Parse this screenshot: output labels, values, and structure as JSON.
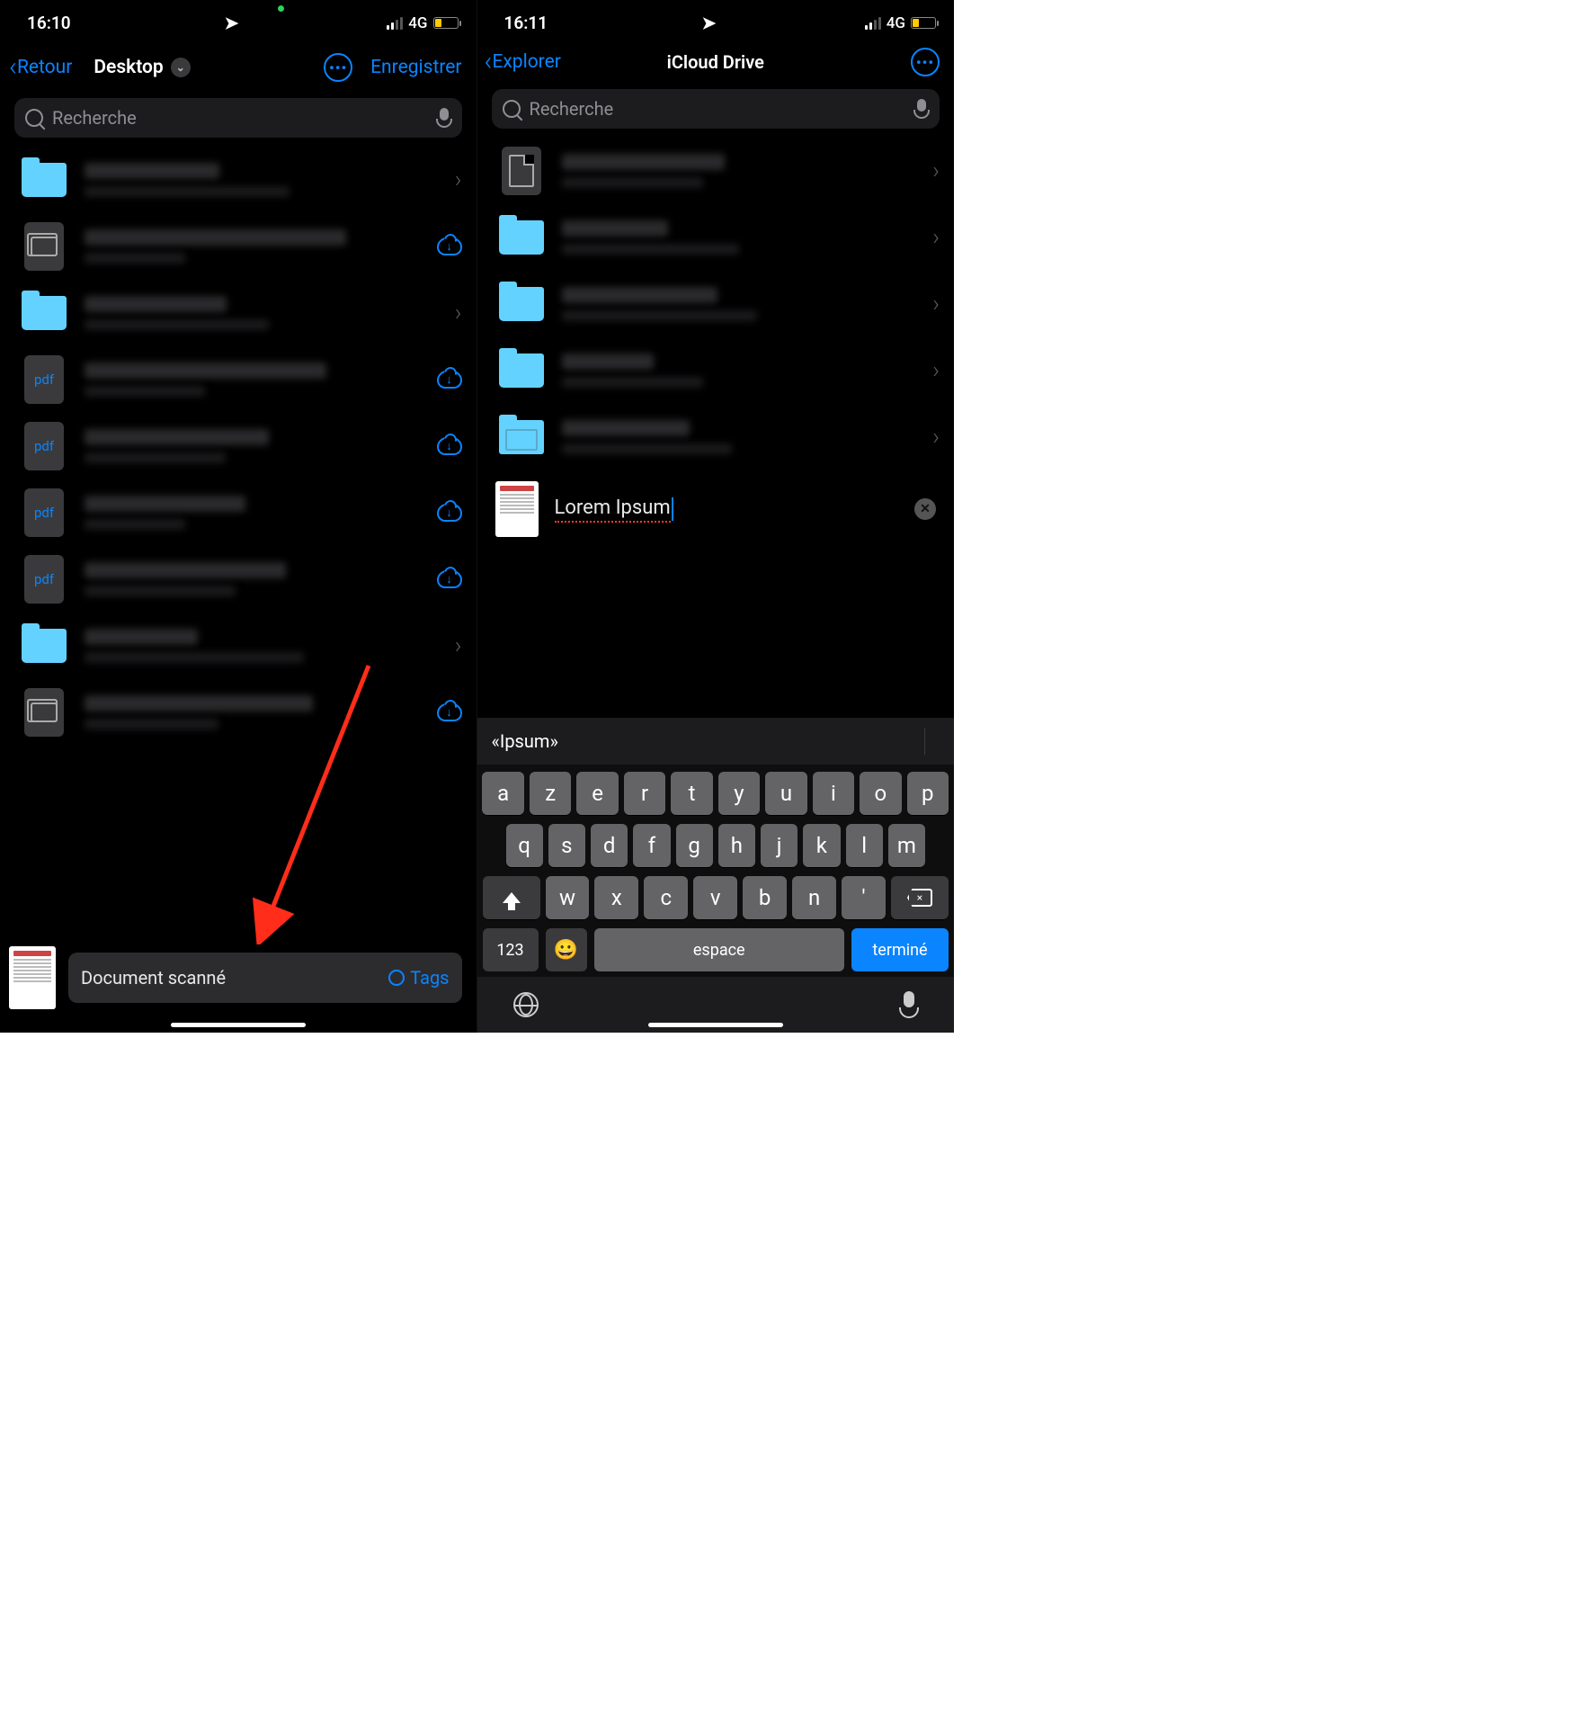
{
  "left": {
    "status": {
      "time": "16:10",
      "network": "4G"
    },
    "nav": {
      "back": "Retour",
      "title": "Desktop",
      "save": "Enregistrer"
    },
    "search": {
      "placeholder": "Recherche"
    },
    "rows": [
      {
        "icon": "folder",
        "accessory": "chevron"
      },
      {
        "icon": "stack",
        "accessory": "cloud"
      },
      {
        "icon": "folder",
        "accessory": "chevron"
      },
      {
        "icon": "pdf",
        "accessory": "cloud"
      },
      {
        "icon": "pdf",
        "accessory": "cloud"
      },
      {
        "icon": "pdf",
        "accessory": "cloud"
      },
      {
        "icon": "pdf",
        "accessory": "cloud"
      },
      {
        "icon": "folder",
        "accessory": "chevron"
      },
      {
        "icon": "stack",
        "accessory": "cloud"
      }
    ],
    "pdf_label": "pdf",
    "bottom": {
      "filename": "Document scanné",
      "tags": "Tags"
    }
  },
  "right": {
    "status": {
      "time": "16:11",
      "network": "4G"
    },
    "nav": {
      "back": "Explorer",
      "title": "iCloud Drive"
    },
    "search": {
      "placeholder": "Recherche"
    },
    "rows": [
      {
        "icon": "page",
        "accessory": "chevron"
      },
      {
        "icon": "folder",
        "accessory": "chevron"
      },
      {
        "icon": "folder",
        "accessory": "chevron"
      },
      {
        "icon": "folder",
        "accessory": "chevron"
      },
      {
        "icon": "desktop",
        "accessory": "chevron"
      }
    ],
    "rename": {
      "value": "Lorem Ipsum"
    },
    "keyboard": {
      "prediction": "«Ipsum»",
      "row1": [
        "a",
        "z",
        "e",
        "r",
        "t",
        "y",
        "u",
        "i",
        "o",
        "p"
      ],
      "row2": [
        "q",
        "s",
        "d",
        "f",
        "g",
        "h",
        "j",
        "k",
        "l",
        "m"
      ],
      "row3": [
        "w",
        "x",
        "c",
        "v",
        "b",
        "n",
        "'"
      ],
      "num": "123",
      "space": "espace",
      "done": "terminé"
    }
  }
}
